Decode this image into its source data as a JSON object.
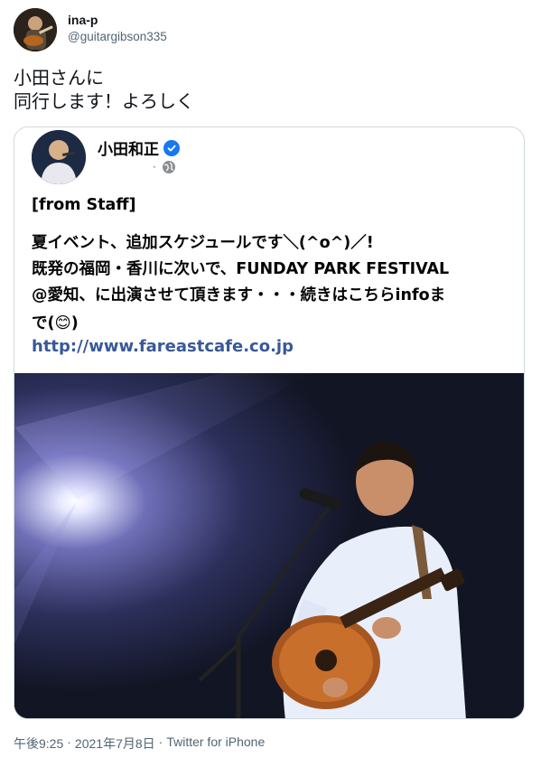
{
  "user": {
    "display_name": "ina-p",
    "handle": "@guitargibson335"
  },
  "tweet": {
    "line1": "小田さんに",
    "line2": "同行します！よろしく"
  },
  "embedded_post": {
    "author": "小田和正",
    "verified": true,
    "meta_dot": "·",
    "lines": [
      "[from Staff]",
      "夏イベント、追加スケジュールです＼(^o^)／!",
      "既発の福岡・香川に次いで、FUNDAY PARK FESTIVAL",
      "@愛知、に出演させて頂きます・・・続きはこちらinfoま",
      "で(😊)"
    ],
    "link": "http://www.fareastcafe.co.jp"
  },
  "footer": {
    "time": "午後9:25",
    "sep1": "·",
    "date": "2021年7月8日",
    "sep2": "·",
    "source": "Twitter for iPhone"
  },
  "colors": {
    "link": "#385898",
    "verified": "#1877f2",
    "muted": "#536471",
    "border": "#cfd9de"
  }
}
